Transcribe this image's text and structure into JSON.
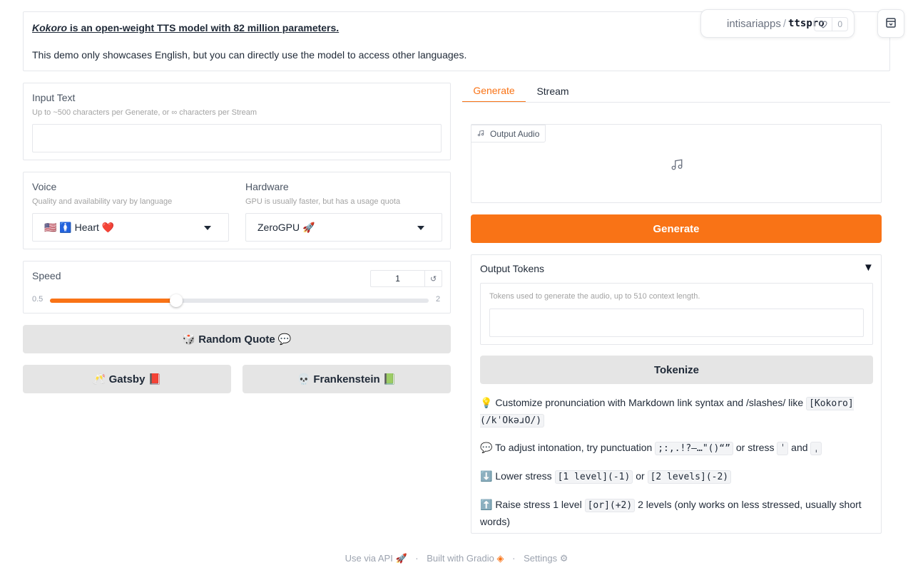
{
  "banner": {
    "model_name": "Kokoro",
    "headline_rest": " is an open-weight TTS model with 82 million parameters.",
    "subline": "This demo only showcases English, but you can directly use the model to access other languages."
  },
  "hf": {
    "owner": "intisariapps",
    "separator": "/",
    "space": "ttspro",
    "likes": "0"
  },
  "input_text": {
    "label": "Input Text",
    "info": "Up to ~500 characters per Generate, or ∞ characters per Stream",
    "value": ""
  },
  "voice": {
    "label": "Voice",
    "info": "Quality and availability vary by language",
    "selected": "🇺🇸 🚺 Heart ❤️"
  },
  "hardware": {
    "label": "Hardware",
    "info": "GPU is usually faster, but has a usage quota",
    "selected": "ZeroGPU 🚀"
  },
  "speed": {
    "label": "Speed",
    "value": 1,
    "value_text": "1",
    "min": 0.5,
    "max": 2,
    "min_text": "0.5",
    "max_text": "2"
  },
  "buttons": {
    "random_quote": "🎲 Random Quote 💬",
    "gatsby": "🥂 Gatsby 📕",
    "frankenstein": "💀 Frankenstein 📗",
    "generate": "Generate",
    "tokenize": "Tokenize"
  },
  "tabs": [
    {
      "label": "Generate",
      "active": true
    },
    {
      "label": "Stream",
      "active": false
    }
  ],
  "output_audio": {
    "label": "Output Audio"
  },
  "output_tokens": {
    "title": "Output Tokens",
    "toggle": "▼",
    "info": "Tokens used to generate the audio, up to 510 context length.",
    "value": ""
  },
  "tips": {
    "t1_text": "💡 Customize pronunciation with Markdown link syntax and /slashes/ like ",
    "t1_code": "[Kokoro](/kˈOkəɹO/)",
    "t2_text": "💬 To adjust intonation, try punctuation ",
    "t2_code1": ";:,.!?—…\"()“”",
    "t2_mid": " or stress ",
    "t2_code2": "ˈ",
    "t2_and": " and ",
    "t2_code3": "ˌ",
    "t3_text": "⬇️ Lower stress ",
    "t3_code1": "[1 level](-1)",
    "t3_or": " or ",
    "t3_code2": "[2 levels](-2)",
    "t4_text": "⬆️ Raise stress 1 level ",
    "t4_code": "[or](+2)",
    "t4_rest": " 2 levels (only works on less stressed, usually short words)"
  },
  "footer": {
    "api": "Use via API",
    "gradio": "Built with Gradio",
    "settings": "Settings"
  },
  "colors": {
    "accent": "#f97316",
    "button_grey": "#e5e5e5",
    "border": "#e5e7eb"
  }
}
